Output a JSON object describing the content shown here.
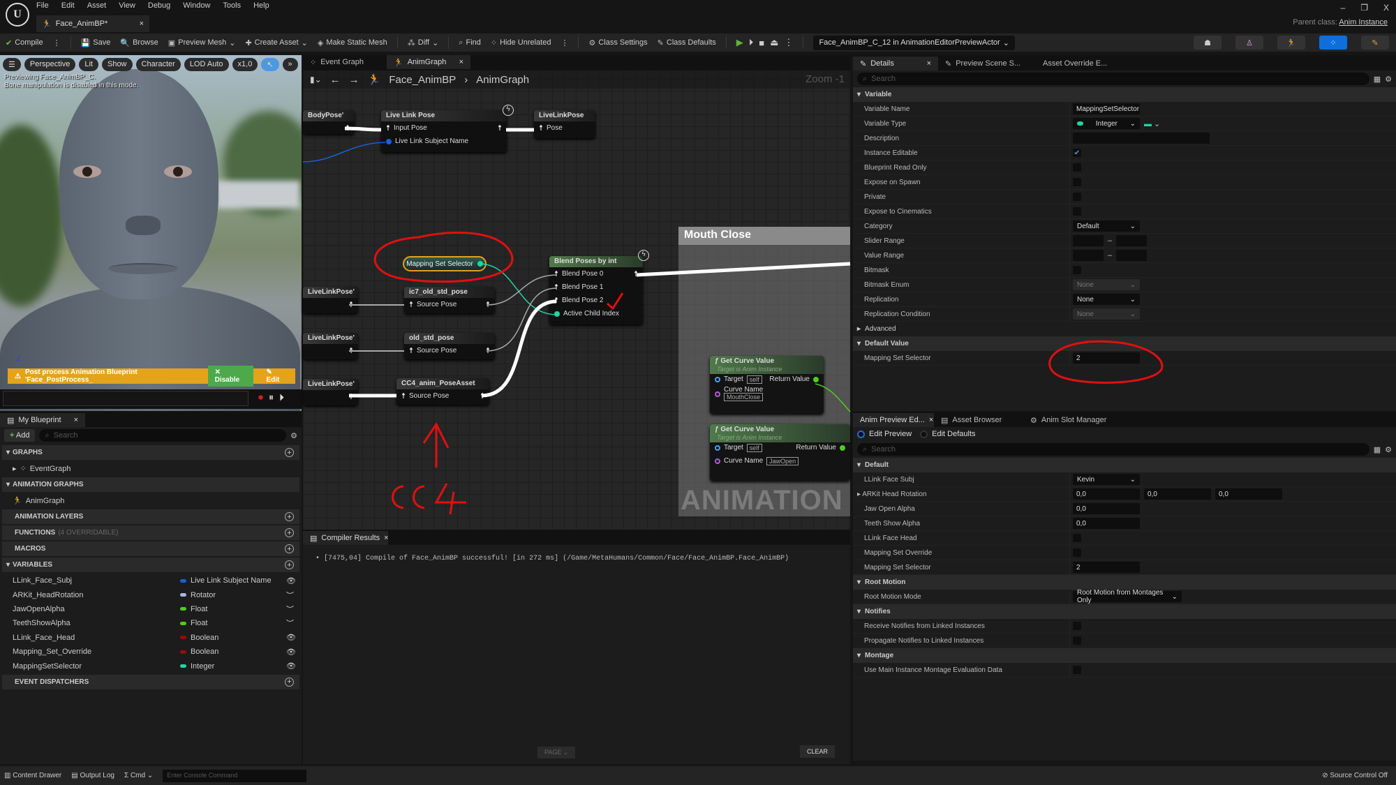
{
  "app": {
    "logo": "U",
    "menu": [
      "File",
      "Edit",
      "Asset",
      "View",
      "Debug",
      "Window",
      "Tools",
      "Help"
    ],
    "document_tab": "Face_AnimBP*",
    "window_controls": [
      "–",
      "❐",
      "X"
    ],
    "parent_class_label": "Parent class:",
    "parent_class_value": "Anim Instance"
  },
  "toolbar": {
    "compile": "Compile",
    "save": "Save",
    "browse": "Browse",
    "preview_mesh": "Preview Mesh",
    "create_asset": "Create Asset",
    "make_static_mesh": "Make Static Mesh",
    "diff": "Diff",
    "find": "Find",
    "hide_unrelated": "Hide Unrelated",
    "class_settings": "Class Settings",
    "class_defaults": "Class Defaults",
    "debug_object": "Face_AnimBP_C_12 in AnimationEditorPreviewActor"
  },
  "viewport": {
    "buttons": [
      "Perspective",
      "Lit",
      "Show",
      "Character",
      "LOD Auto",
      "x1,0"
    ],
    "info_line1": "Previewing Face_AnimBP_C.",
    "info_line2": "Bone manipulation is disabled in this mode.",
    "warning": "Post process Animation Blueprint 'Face_PostProcess_",
    "disable": "Disable",
    "edit": "Edit",
    "axis": "Z"
  },
  "my_blueprint": {
    "tab": "My Blueprint",
    "add": "Add",
    "search_placeholder": "Search",
    "graphs_header": "GRAPHS",
    "event_graph": "EventGraph",
    "anim_graphs_header": "ANIMATION GRAPHS",
    "anim_graph": "AnimGraph",
    "anim_layers_header": "ANIMATION LAYERS",
    "functions_header": "FUNCTIONS",
    "functions_sub": "(4 OVERRIDABLE)",
    "macros_header": "MACROS",
    "variables_header": "VARIABLES",
    "event_dispatchers_header": "EVENT DISPATCHERS",
    "variables": [
      {
        "name": "LLink_Face_Subj",
        "type": "Live Link Subject Name",
        "color": "#1a5fd6",
        "visible": true
      },
      {
        "name": "ARKit_HeadRotation",
        "type": "Rotator",
        "color": "#a8b4f0",
        "visible": false
      },
      {
        "name": "JawOpenAlpha",
        "type": "Float",
        "color": "#4fcc1e",
        "visible": false
      },
      {
        "name": "TeethShowAlpha",
        "type": "Float",
        "color": "#4fcc1e",
        "visible": false
      },
      {
        "name": "LLink_Face_Head",
        "type": "Boolean",
        "color": "#9a0a0a",
        "visible": true
      },
      {
        "name": "Mapping_Set_Override",
        "type": "Boolean",
        "color": "#9a0a0a",
        "visible": true
      },
      {
        "name": "MappingSetSelector",
        "type": "Integer",
        "color": "#1fd6a0",
        "visible": true
      }
    ]
  },
  "graph": {
    "tabs": [
      "Event Graph",
      "AnimGraph"
    ],
    "breadcrumb": [
      "Face_AnimBP",
      "AnimGraph"
    ],
    "zoom": "Zoom -1",
    "nodes": {
      "body_pose": "BodyPose'",
      "live_link_pose": "Live Link Pose",
      "input_pose": "Input Pose",
      "live_link_subject": "Live Link Subject Name",
      "livelinkpose_out": "LiveLinkPose",
      "pose": "Pose",
      "mapping_set_selector": "Mapping Set Selector",
      "blend_poses": "Blend Poses by int",
      "blend_pose_0": "Blend Pose 0",
      "blend_pose_1": "Blend Pose 1",
      "blend_pose_2": "Blend Pose 2",
      "active_child_index": "Active Child Index",
      "livelink_left": "LiveLinkPose'",
      "ic7": "ic7_old_std_pose",
      "old_std": "old_std_pose",
      "cc4": "CC4_anim_PoseAsset",
      "source_pose": "Source Pose",
      "comment": "Mouth Close",
      "get_curve": "Get Curve Value",
      "target_is": "Target is Anim Instance",
      "target": "Target",
      "self": "self",
      "return_value": "Return Value",
      "curve_name": "Curve Name",
      "curve1": "MouthClose",
      "curve2": "JawOpen",
      "watermark": "ANIMATION"
    },
    "annotation_text": "CC4"
  },
  "compiler": {
    "tab": "Compiler Results",
    "message": "[7475,04] Compile of Face_AnimBP successful! [in 272 ms] (/Game/MetaHumans/Common/Face/Face_AnimBP.Face_AnimBP)",
    "page": "PAGE",
    "clear": "CLEAR"
  },
  "details": {
    "tabs": [
      "Details",
      "Preview Scene S...",
      "Asset Override E..."
    ],
    "search_placeholder": "Search",
    "variable_header": "Variable",
    "rows": [
      {
        "label": "Variable Name",
        "kind": "input",
        "value": "MappingSetSelector"
      },
      {
        "label": "Variable Type",
        "kind": "type",
        "value": "Integer"
      },
      {
        "label": "Description",
        "kind": "wide",
        "value": ""
      },
      {
        "label": "Instance Editable",
        "kind": "check",
        "checked": true
      },
      {
        "label": "Blueprint Read Only",
        "kind": "check",
        "checked": false
      },
      {
        "label": "Expose on Spawn",
        "kind": "check",
        "checked": false
      },
      {
        "label": "Private",
        "kind": "check",
        "checked": false
      },
      {
        "label": "Expose to Cinematics",
        "kind": "check",
        "checked": false
      },
      {
        "label": "Category",
        "kind": "select",
        "value": "Default"
      },
      {
        "label": "Slider Range",
        "kind": "range"
      },
      {
        "label": "Value Range",
        "kind": "range"
      },
      {
        "label": "Bitmask",
        "kind": "check",
        "checked": false
      },
      {
        "label": "Bitmask Enum",
        "kind": "select-dis",
        "value": "None"
      },
      {
        "label": "Replication",
        "kind": "select",
        "value": "None"
      },
      {
        "label": "Replication Condition",
        "kind": "select-dis",
        "value": "None"
      }
    ],
    "advanced": "Advanced",
    "default_value_header": "Default Value",
    "default_label": "Mapping Set Selector",
    "default_value": "2"
  },
  "preview": {
    "tabs": [
      "Anim Preview Ed...",
      "Asset Browser",
      "Anim Slot Manager"
    ],
    "edit_preview": "Edit Preview",
    "edit_defaults": "Edit Defaults",
    "search_placeholder": "Search",
    "sections": [
      {
        "title": "Default",
        "rows": [
          {
            "label": "LLink Face Subj",
            "kind": "select",
            "value": "Kevin"
          },
          {
            "label": "ARKit Head Rotation",
            "kind": "vec3",
            "values": [
              "0,0",
              "0,0",
              "0,0"
            ],
            "expandable": true
          },
          {
            "label": "Jaw Open Alpha",
            "kind": "input",
            "value": "0,0"
          },
          {
            "label": "Teeth Show Alpha",
            "kind": "input",
            "value": "0,0"
          },
          {
            "label": "LLink Face Head",
            "kind": "check",
            "checked": false
          },
          {
            "label": "Mapping Set Override",
            "kind": "check",
            "checked": false
          },
          {
            "label": "Mapping Set Selector",
            "kind": "input",
            "value": "2"
          }
        ]
      },
      {
        "title": "Root Motion",
        "rows": [
          {
            "label": "Root Motion Mode",
            "kind": "select-wide",
            "value": "Root Motion from Montages Only"
          }
        ]
      },
      {
        "title": "Notifies",
        "rows": [
          {
            "label": "Receive Notifies from Linked Instances",
            "kind": "check",
            "checked": false
          },
          {
            "label": "Propagate Notifies to Linked Instances",
            "kind": "check",
            "checked": false
          }
        ]
      },
      {
        "title": "Montage",
        "rows": [
          {
            "label": "Use Main Instance Montage Evaluation Data",
            "kind": "check",
            "checked": false
          }
        ]
      }
    ]
  },
  "status": {
    "content_drawer": "Content Drawer",
    "output_log": "Output Log",
    "cmd": "Cmd",
    "console_placeholder": "Enter Console Command",
    "source_control": "Source Control Off"
  },
  "colors": {
    "accent": "#0e6fdc",
    "annotation": "#e01010",
    "warning": "#e3a41b",
    "integer_pin": "#1fd6a0"
  }
}
